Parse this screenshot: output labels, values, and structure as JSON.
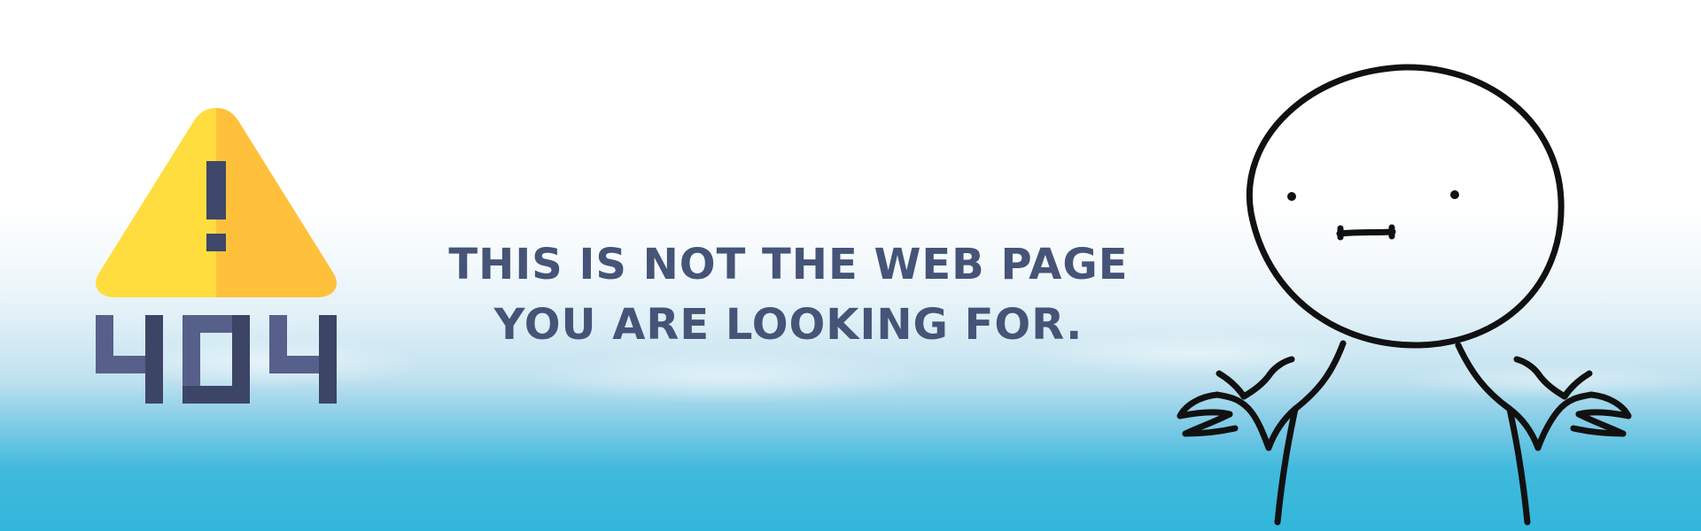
{
  "error": {
    "code_digits": "404",
    "warning_symbol": "!"
  },
  "message": {
    "line1": "THIS IS NOT THE WEB PAGE",
    "line2": "YOU ARE LOOKING FOR."
  },
  "icons": {
    "warning": "warning-triangle-icon",
    "character": "shrugging-stick-figure"
  },
  "colors": {
    "text": "#455477",
    "warning_yellow_left": "#ffdd3f",
    "warning_yellow_right": "#ffc13c",
    "digits_light": "#56608a",
    "digits_dark": "#3d4566",
    "sea": "#33b6db"
  }
}
